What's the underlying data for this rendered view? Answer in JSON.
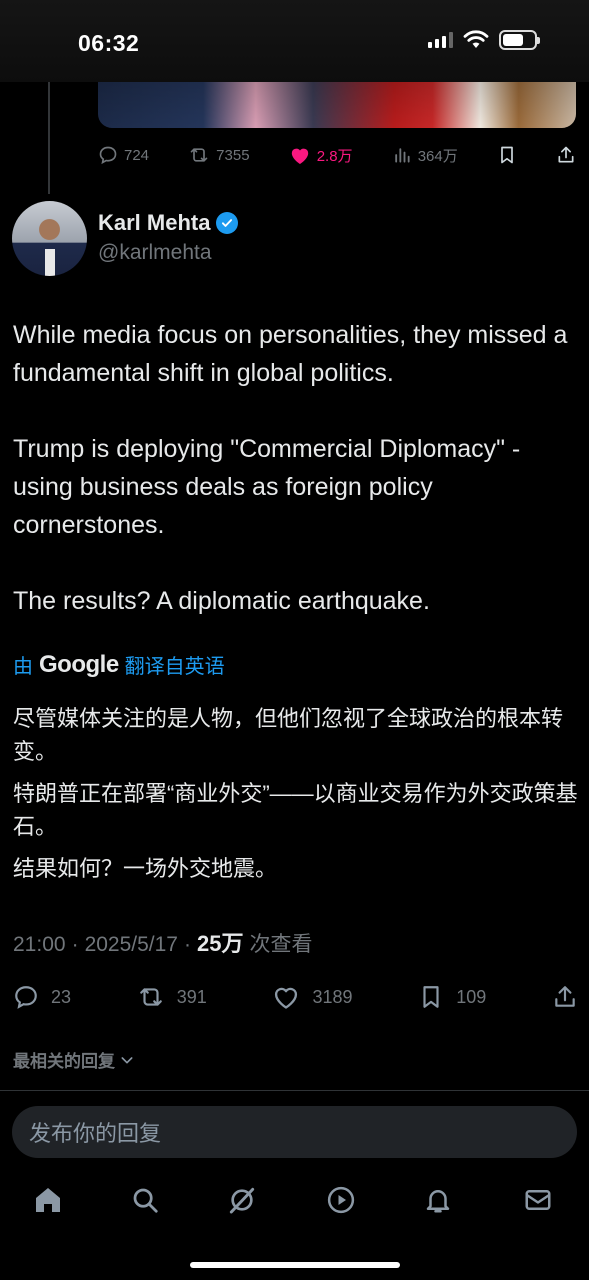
{
  "status_bar": {
    "time": "06:32"
  },
  "previous_tweet": {
    "stats": {
      "replies": "724",
      "retweets": "7355",
      "likes": "2.8万",
      "views": "364万"
    }
  },
  "tweet": {
    "author": {
      "name": "Karl Mehta",
      "handle": "@karlmehta",
      "verified": true
    },
    "paragraphs": [
      "While media focus on personalities, they missed a fundamental shift in global politics.",
      "Trump is deploying \"Commercial Diplomacy\" - using business deals as foreign policy cornerstones.",
      "The results? A diplomatic earthquake."
    ],
    "translation_prefix": "由",
    "translation_brand": "Google",
    "translation_suffix": "翻译自英语",
    "translated_paragraphs": [
      "尽管媒体关注的是人物，但他们忽视了全球政治的根本转变。",
      "特朗普正在部署“商业外交”——以商业交易作为外交政策基石。",
      "结果如何？一场外交地震。"
    ],
    "time": "21:00",
    "date": "2025/5/17",
    "views_count": "25万",
    "views_label": "次查看",
    "stats": {
      "replies": "23",
      "retweets": "391",
      "likes": "3189",
      "bookmarks": "109"
    }
  },
  "replies_sort_label": "最相关的回复",
  "reply_placeholder": "发布你的回复",
  "colors": {
    "accent": "#1d9bf0",
    "like": "#f91880",
    "muted": "#71767b",
    "background": "#000000"
  },
  "nav": [
    "home-icon",
    "search-icon",
    "grok-icon",
    "video-icon",
    "notifications-icon",
    "messages-icon"
  ]
}
